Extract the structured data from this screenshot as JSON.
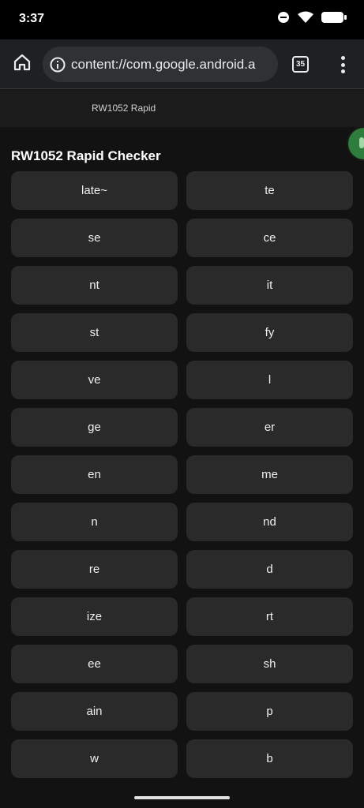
{
  "status_bar": {
    "time": "3:37",
    "icons": [
      "do-not-disturb-icon",
      "wifi-icon",
      "battery-icon"
    ]
  },
  "browser": {
    "url": "content://com.google.android.a",
    "tab_count": "35"
  },
  "page": {
    "header_title": "RW1052 Rapid",
    "heading": "RW1052 Rapid Checker"
  },
  "choices": [
    {
      "label": "late~"
    },
    {
      "label": "te"
    },
    {
      "label": "se"
    },
    {
      "label": "ce"
    },
    {
      "label": "nt"
    },
    {
      "label": "it"
    },
    {
      "label": "st"
    },
    {
      "label": "fy"
    },
    {
      "label": "ve"
    },
    {
      "label": "l"
    },
    {
      "label": "ge"
    },
    {
      "label": "er"
    },
    {
      "label": "en"
    },
    {
      "label": "me"
    },
    {
      "label": "n"
    },
    {
      "label": "nd"
    },
    {
      "label": "re"
    },
    {
      "label": "d"
    },
    {
      "label": "ize"
    },
    {
      "label": "rt"
    },
    {
      "label": "ee"
    },
    {
      "label": "sh"
    },
    {
      "label": "ain"
    },
    {
      "label": "p"
    },
    {
      "label": "w"
    },
    {
      "label": "b"
    }
  ],
  "colors": {
    "background": "#121212",
    "button": "#2a2a2a",
    "accent_green": "#2e7d3d"
  }
}
